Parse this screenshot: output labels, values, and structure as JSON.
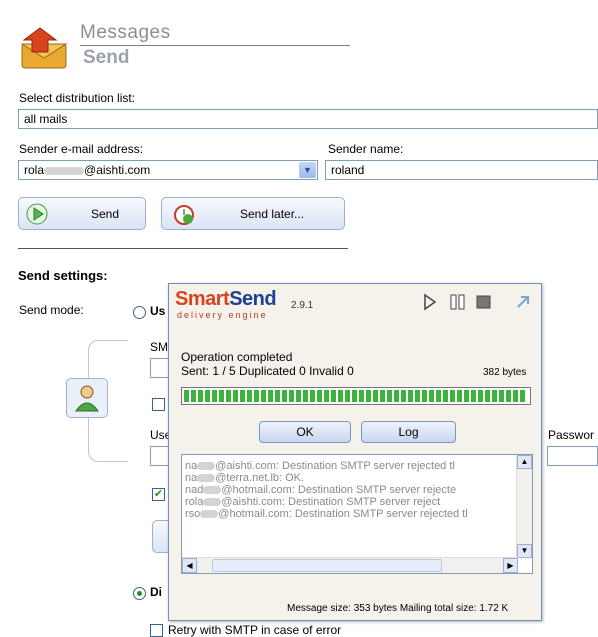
{
  "header": {
    "title": "Messages",
    "subtitle": "Send"
  },
  "distribution": {
    "label": "Select distribution list:",
    "value": "all mails"
  },
  "sender_email": {
    "label": "Sender e-mail address:",
    "value_prefix": "rola",
    "value_suffix": "@aishti.com"
  },
  "sender_name": {
    "label": "Sender name:",
    "value": "roland"
  },
  "buttons": {
    "send": "Send",
    "send_later": "Send later..."
  },
  "settings": {
    "heading": "Send settings:",
    "send_mode_label": "Send mode:",
    "radio1_partial": "Us",
    "smtp_partial": "SM",
    "user_partial": "Use",
    "password_partial": "Passwor",
    "radio2_partial": "Di",
    "retry_label": "Retry with SMTP in case of error"
  },
  "dialog": {
    "brand_a": "Smart",
    "brand_b": "Send",
    "tagline": "delivery engine",
    "version": "2.9.1",
    "status": "Operation completed",
    "counts": "Sent: 1 / 5 Duplicated 0 Invalid 0",
    "bytes": "382 bytes",
    "progress": 1.0,
    "ok": "OK",
    "log": "Log",
    "log_lines": [
      {
        "pre": "na",
        "text": "@aishti.com: Destination SMTP server rejected tl"
      },
      {
        "pre": "na",
        "text": "@terra.net.lb: OK."
      },
      {
        "pre": "nad",
        "text": "@hotmail.com: Destination SMTP server rejecte"
      },
      {
        "pre": "rola",
        "text": "@aishti.com: Destination SMTP server reject"
      },
      {
        "pre": "rso",
        "text": "@hotmail.com: Destination SMTP server rejected tl"
      }
    ],
    "footer": "Message size: 353 bytes  Mailing total size: 1.72 K"
  },
  "colors": {
    "accent": "#1f3f8f",
    "brand": "#d8431f",
    "progress": "#3cb43c"
  }
}
